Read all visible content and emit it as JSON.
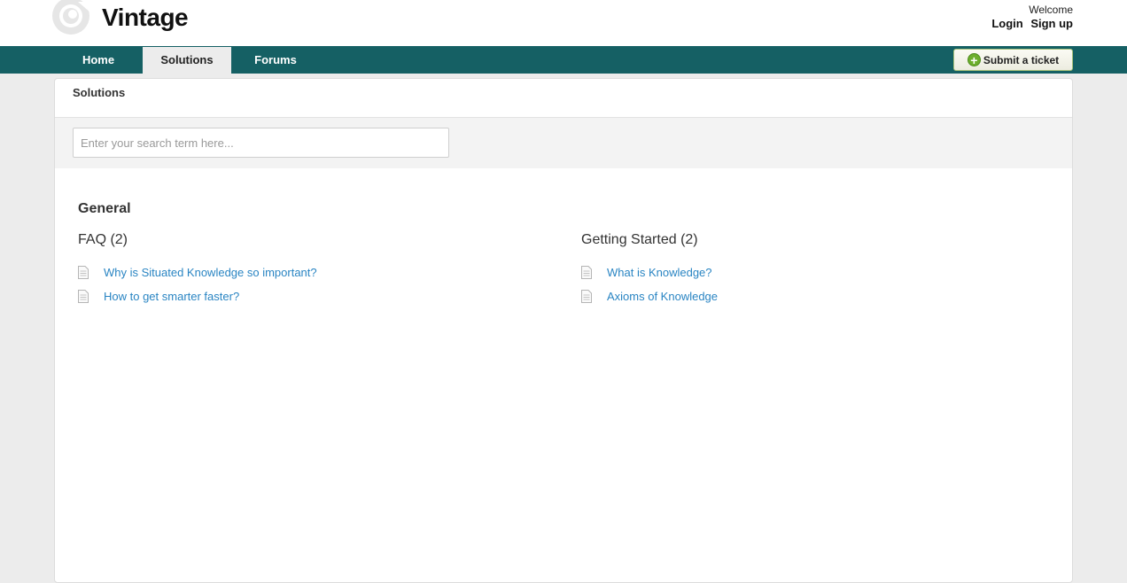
{
  "header": {
    "brand": "Vintage",
    "welcome": "Welcome",
    "login": "Login",
    "signup": "Sign up"
  },
  "nav": {
    "tabs": [
      {
        "label": "Home"
      },
      {
        "label": "Solutions",
        "active": true
      },
      {
        "label": "Forums"
      }
    ],
    "submit_ticket": "Submit a ticket"
  },
  "colors": {
    "nav_bg": "#156064",
    "link": "#2a85c3"
  },
  "panel": {
    "title": "Solutions",
    "search_placeholder": "Enter your search term here..."
  },
  "category": {
    "name": "General",
    "folders": [
      {
        "title": "FAQ (2)",
        "articles": [
          {
            "title": "Why is Situated Knowledge so important?"
          },
          {
            "title": "How to get smarter faster?"
          }
        ]
      },
      {
        "title": "Getting Started (2)",
        "articles": [
          {
            "title": "What is Knowledge?"
          },
          {
            "title": "Axioms of Knowledge"
          }
        ]
      }
    ]
  }
}
